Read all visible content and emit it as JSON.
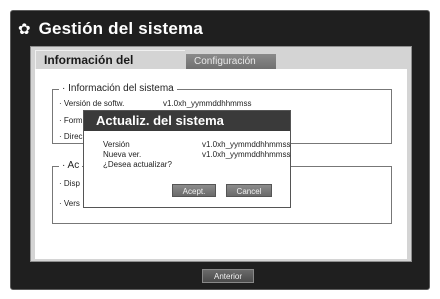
{
  "header": {
    "icon": "gear-icon",
    "title": "Gestión del sistema"
  },
  "tabs": [
    {
      "label": "Información del sistema",
      "active": true
    },
    {
      "label": "Configuración",
      "active": false
    }
  ],
  "system_info": {
    "legend": "· Información del sistema",
    "rows": [
      {
        "label": "· Versión de softw.",
        "value": "v1.0xh_yymmddhhmmss"
      },
      {
        "label": "· Form",
        "value": ""
      },
      {
        "label": "· Direc",
        "value": ""
      }
    ]
  },
  "update_group": {
    "legend": "· Ac",
    "rows": [
      {
        "label": "· Disp",
        "value": ""
      },
      {
        "label": "· Vers",
        "value": ""
      }
    ]
  },
  "dialog": {
    "title": "Actualiz. del sistema",
    "version_label": "Versión",
    "version_value": "v1.0xh_yymmddhhmmss",
    "new_label": "Nueva ver.",
    "new_value": "v1.0xh_yymmddhhmmss",
    "question": "¿Desea actualizar?",
    "accept_label": "Acept.",
    "cancel_label": "Cancel"
  },
  "footer": {
    "prev_label": "Anterior"
  }
}
